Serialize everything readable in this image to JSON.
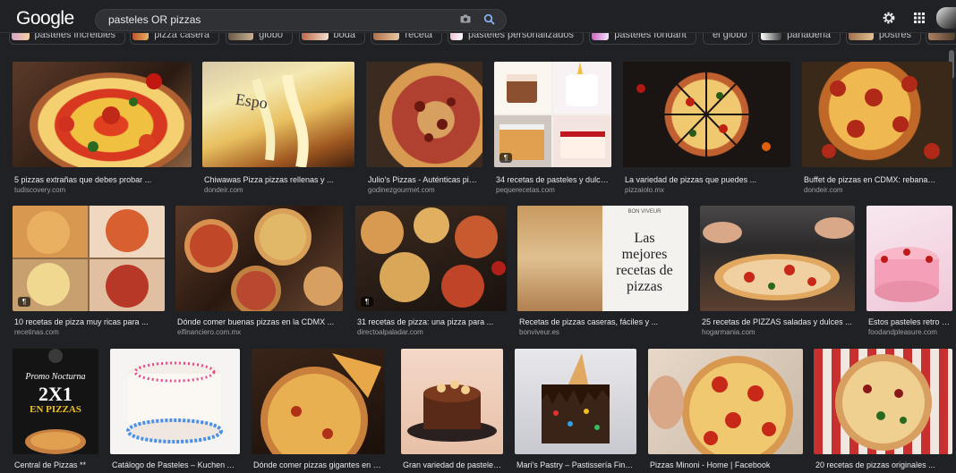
{
  "header": {
    "logo": "Google",
    "query": "pasteles OR pizzas",
    "icons": [
      "camera-icon",
      "search-icon",
      "gear-icon",
      "apps-grid-icon",
      "avatar"
    ]
  },
  "chips": [
    {
      "label": "pasteles increibles"
    },
    {
      "label": "pizza casera"
    },
    {
      "label": "globo"
    },
    {
      "label": "boda"
    },
    {
      "label": "receta"
    },
    {
      "label": "pasteles personalizados"
    },
    {
      "label": "pasteles fondant"
    },
    {
      "label": "el globo"
    },
    {
      "label": "panaderia"
    },
    {
      "label": "postres"
    }
  ],
  "results": [
    {
      "caption": "5 pizzas extrañas que debes probar ...",
      "source": "tudiscovery.com",
      "badge": ""
    },
    {
      "caption": "Chiwawas Pizza pizzas rellenas y ...",
      "source": "dondeir.com",
      "badge": ""
    },
    {
      "caption": "Julio's Pizzas - Auténticas pizza...",
      "source": "godinezgourmet.com",
      "badge": ""
    },
    {
      "caption": "34 recetas de pasteles y dulces ...",
      "source": "pequerecetas.com",
      "badge": "¶"
    },
    {
      "caption": "La variedad de pizzas que puedes ...",
      "source": "pizzaiolo.mx",
      "badge": ""
    },
    {
      "caption": "Buffet de pizzas en CDMX: rebanadas ...",
      "source": "dondeir.com",
      "badge": ""
    },
    {
      "caption": "10 recetas de pizza muy ricas para ...",
      "source": "recetinas.com",
      "badge": "¶"
    },
    {
      "caption": "Dónde comer buenas pizzas en la CDMX ...",
      "source": "elfinanciero.com.mx",
      "badge": ""
    },
    {
      "caption": "31 recetas de pizza: una pizza para ...",
      "source": "directoalpaladar.com",
      "badge": "¶"
    },
    {
      "caption": "Recetas de pizzas caseras, fáciles y ...",
      "source": "bonviveur.es",
      "badge": ""
    },
    {
      "caption": "25 recetas de PIZZAS saladas y dulces ...",
      "source": "hogarmania.com",
      "badge": ""
    },
    {
      "caption": "Estos pasteles retro se...",
      "source": "foodandpleasure.com",
      "badge": ""
    },
    {
      "caption": "Central de Pizzas **",
      "source": "",
      "badge": ""
    },
    {
      "caption": "Catálogo de Pasteles – Kuchen Alta ...",
      "source": "",
      "badge": ""
    },
    {
      "caption": "Dónde comer pizzas gigantes en CDM...",
      "source": "",
      "badge": ""
    },
    {
      "caption": "Gran variedad de pasteles ...",
      "source": "",
      "badge": ""
    },
    {
      "caption": "Mari's Pastry – Pastissería Fina J...",
      "source": "",
      "badge": ""
    },
    {
      "caption": "Pizzas Minoni - Home | Facebook",
      "source": "",
      "badge": ""
    },
    {
      "caption": "20 recetas de pizzas originales ...",
      "source": "",
      "badge": ""
    }
  ],
  "image_text": {
    "las_mejores": [
      "Las",
      "mejores",
      "recetas de",
      "pizzas"
    ],
    "bonviveur_tag": "BON VIVEUR",
    "promo_title": "Promo Nocturna",
    "promo_price": "2X1",
    "promo_sub": "EN PIZZAS",
    "sign_text": "Espo"
  },
  "colors": {
    "background": "#202124",
    "search_bg": "#303134",
    "caption": "#e8eaed",
    "source": "#9aa0a6",
    "accent_search": "#8ab4f8"
  }
}
